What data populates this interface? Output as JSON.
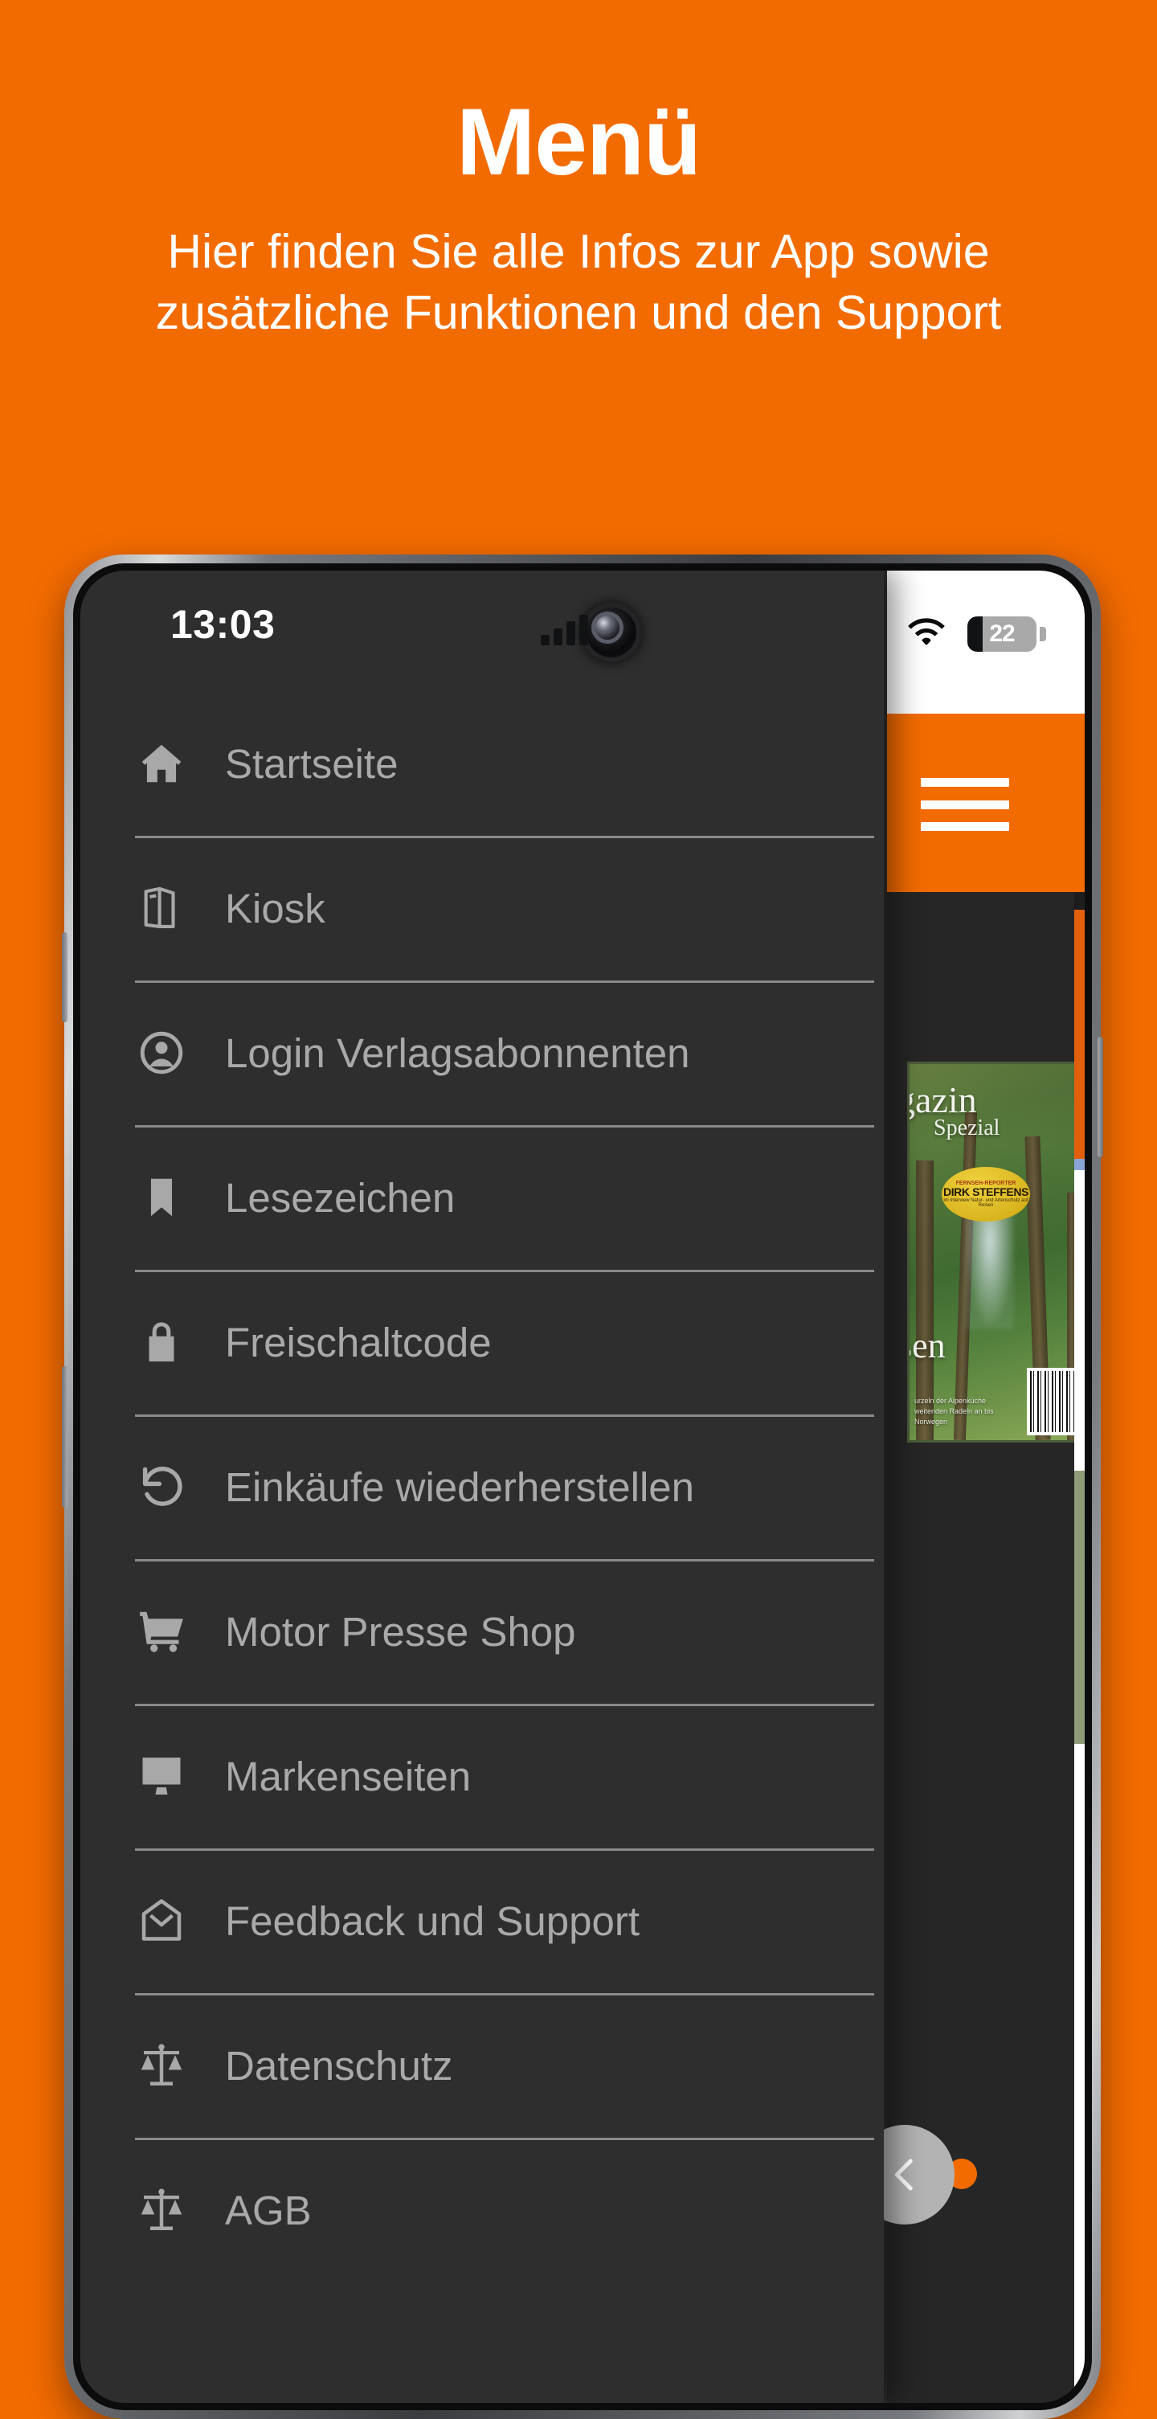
{
  "promo": {
    "title": "Menü",
    "subtitle": "Hier finden Sie alle Infos zur App sowie zusätzliche Funktionen und den Support",
    "background_color": "#F26B00",
    "text_color": "#FFFFFF"
  },
  "phone": {
    "statusbar": {
      "time": "13:03",
      "signal_icon": "cellular-signal-icon",
      "wifi_icon": "wifi-icon",
      "battery_icon": "battery-icon",
      "battery_percent": "22",
      "camera_icon": "front-camera-icon"
    },
    "appbar": {
      "menu_icon": "hamburger-menu-icon",
      "accent_color": "#F26B00"
    },
    "drawer": {
      "surface_color": "#2E2E2E",
      "label_color": "#A9A9A9",
      "items": [
        {
          "label": "Startseite",
          "icon": "home-icon"
        },
        {
          "label": "Kiosk",
          "icon": "book-open-icon"
        },
        {
          "label": "Login Verlagsabonnenten",
          "icon": "account-circle-icon"
        },
        {
          "label": "Lesezeichen",
          "icon": "bookmark-icon"
        },
        {
          "label": "Freischaltcode",
          "icon": "lock-icon"
        },
        {
          "label": "Einkäufe wiederherstellen",
          "icon": "restore-icon"
        },
        {
          "label": "Motor Presse Shop",
          "icon": "shopping-cart-icon"
        },
        {
          "label": "Markenseiten",
          "icon": "desktop-monitor-icon"
        },
        {
          "label": "Feedback und Support",
          "icon": "envelope-icon"
        },
        {
          "label": "Datenschutz",
          "icon": "balance-scale-icon"
        },
        {
          "label": "AGB",
          "icon": "balance-scale-icon"
        }
      ]
    },
    "background_content": {
      "magazine_cover": {
        "title": "gazin",
        "subtitle": "Spezial",
        "badge_kicker": "FERNSEH-REPORTER",
        "badge_name": "DIRK STEFFENS",
        "badge_sub": "im Interview Natur- und Artenschutz auf Reisen",
        "headline_fragment": "sen",
        "footer_lines": "urzeln der Alpenküche weitenden Radeln an bis Norwegen",
        "barcode_icon": "barcode-icon"
      }
    },
    "floating_button": {
      "icon": "chevron-left-icon",
      "background_color": "#B3B3B3",
      "indicator_color": "#F26B00"
    }
  }
}
